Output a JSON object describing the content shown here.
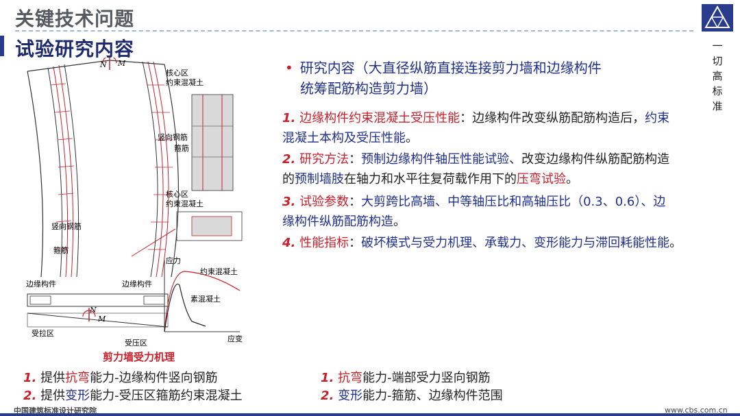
{
  "header": {
    "title": "关键技术问题",
    "subtitle": "试验研究内容",
    "logo_text": [
      "一",
      "切",
      "高",
      "标",
      "准"
    ]
  },
  "bullet": {
    "line1": "研究内容（大直径纵筋直接连接剪力墙和边缘构件",
    "line2": "统筹配筋构造剪力墙）"
  },
  "items": [
    {
      "num": "1.",
      "red_label": "边缘构件约束混凝土受压性能",
      "rest1": "：边缘构件改变纵筋配筋构造后，",
      "blue1": "约束",
      "line2_blue": "混凝土本构及受压性能",
      "line2_rest": "。"
    },
    {
      "num": "2.",
      "red_label": "研究方法",
      "sep": "：",
      "blue1": "预制边缘构件轴压性能试验",
      "rest1": "、改变边缘构件纵筋配筋构造",
      "line2_a": "的",
      "line2_blue": "预制墙肢",
      "line2_b": "在轴力和水平往复荷载作用下的",
      "line2_red": "压弯试验",
      "line2_end": "。"
    },
    {
      "num": "3.",
      "red_label": "试验参数",
      "sep": "：",
      "blue1": "大剪跨比高墙、中等轴压比和高轴压比（0.3、0.6）、边",
      "line2_blue": "缘构件纵筋配筋构造",
      "line2_end": "。"
    },
    {
      "num": "4.",
      "red_label": "性能指标",
      "sep": "：",
      "blue1": "破坏模式与受力机理、承载力、变形能力与滞回耗能性能",
      "end": "。"
    }
  ],
  "figure": {
    "caption": "剪力墙受力机理",
    "labels": {
      "N": "N",
      "M": "M",
      "core_zone1": "核心区",
      "confined1": "约束混凝土",
      "vertical_bar1": "竖向钢筋",
      "stirrup1": "箍筋",
      "core_zone2": "核心区",
      "confined2": "约束混凝土",
      "vertical_bar2": "竖向钢筋",
      "stirrup2": "箍筋",
      "edge_left": "边缘构件",
      "edge_right": "边缘构件",
      "tension": "受拉区",
      "compression": "受压区",
      "stress": "应力",
      "strain": "应变",
      "confined_curve": "约束混凝土",
      "plain_curve": "素混凝土"
    }
  },
  "bottom_left": [
    {
      "num": "1.",
      "a": "提供",
      "red": "抗弯",
      "b": "能力-边缘构件竖向钢筋"
    },
    {
      "num": "2.",
      "a": "提供",
      "blue": "变形",
      "b": "能力-受压区箍筋约束混凝土"
    }
  ],
  "bottom_right": [
    {
      "num": "1.",
      "red": "抗弯",
      "b": "能力-端部受力竖向钢筋"
    },
    {
      "num": "2.",
      "blue": "变形",
      "b": "能力-箍筋、边缘构件范围"
    }
  ],
  "footer": {
    "left": "中国建筑标准设计研究院",
    "right": "www.cbs.com.cn"
  },
  "colors": {
    "accent_red": "#c8202a",
    "accent_blue": "#1f2f8c",
    "brand": "#2a3a8c"
  }
}
